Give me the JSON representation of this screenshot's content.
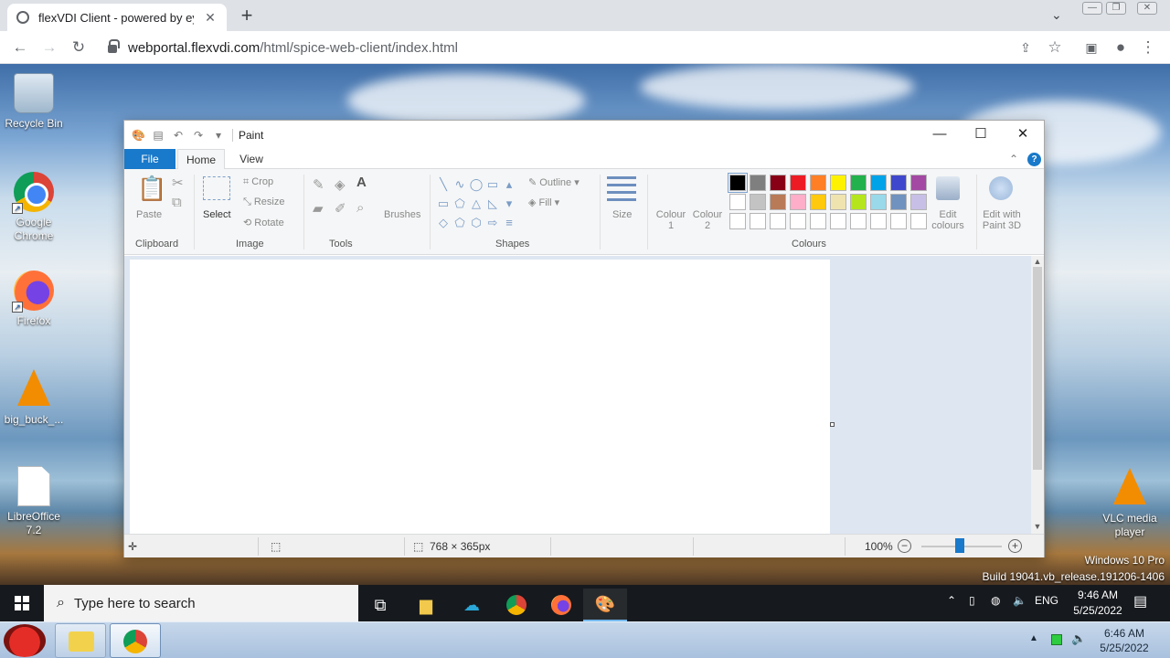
{
  "browser": {
    "tab_title": "flexVDI Client - powered by ey",
    "url_host": "webportal.flexvdi.com",
    "url_path": "/html/spice-web-client/index.html"
  },
  "desktop": {
    "icons": [
      {
        "label": "Recycle Bin",
        "icon": "recycle-bin-icon"
      },
      {
        "label": "Google Chrome",
        "icon": "chrome-icon"
      },
      {
        "label": "Firefox",
        "icon": "firefox-icon"
      },
      {
        "label": "big_buck_...",
        "icon": "vlc-icon"
      },
      {
        "label": "LibreOffice 7.2",
        "icon": "libreoffice-icon"
      },
      {
        "label": "VLC media player",
        "icon": "vlc-icon"
      }
    ],
    "watermark_line1": "Windows 10 Pro",
    "watermark_line2": "Build 19041.vb_release.191206-1406"
  },
  "paint": {
    "title": "Paint",
    "tabs": {
      "file": "File",
      "home": "Home",
      "view": "View"
    },
    "groups": {
      "clipboard": "Clipboard",
      "image": "Image",
      "tools": "Tools",
      "shapes": "Shapes",
      "colours": "Colours"
    },
    "buttons": {
      "paste": "Paste",
      "select": "Select",
      "crop": "Crop",
      "resize": "Resize",
      "rotate": "Rotate",
      "brushes": "Brushes",
      "outline": "Outline",
      "fill": "Fill",
      "size": "Size",
      "colour1_line1": "Colour",
      "colour1_line2": "1",
      "colour2_line1": "Colour",
      "colour2_line2": "2",
      "edit_colours_line1": "Edit",
      "edit_colours_line2": "colours",
      "paint3d_line1": "Edit with",
      "paint3d_line2": "Paint 3D"
    },
    "palette_row1": [
      "#000000",
      "#7f7f7f",
      "#880015",
      "#ed1c24",
      "#ff7f27",
      "#fff200",
      "#22b14c",
      "#00a2e8",
      "#3f48cc",
      "#a349a4"
    ],
    "palette_row2": [
      "#ffffff",
      "#c3c3c3",
      "#b97a57",
      "#ffaec9",
      "#ffc90e",
      "#efe4b0",
      "#b5e61d",
      "#99d9ea",
      "#7092be",
      "#c8bfe7"
    ],
    "status": {
      "image_size": "768 × 365px",
      "zoom": "100%",
      "zoom_level_percent": 100
    }
  },
  "taskbar": {
    "search_placeholder": "Type here to search",
    "language": "ENG",
    "time": "9:46 AM",
    "date": "5/25/2022"
  },
  "host_taskbar": {
    "time": "6:46 AM",
    "date": "5/25/2022"
  }
}
